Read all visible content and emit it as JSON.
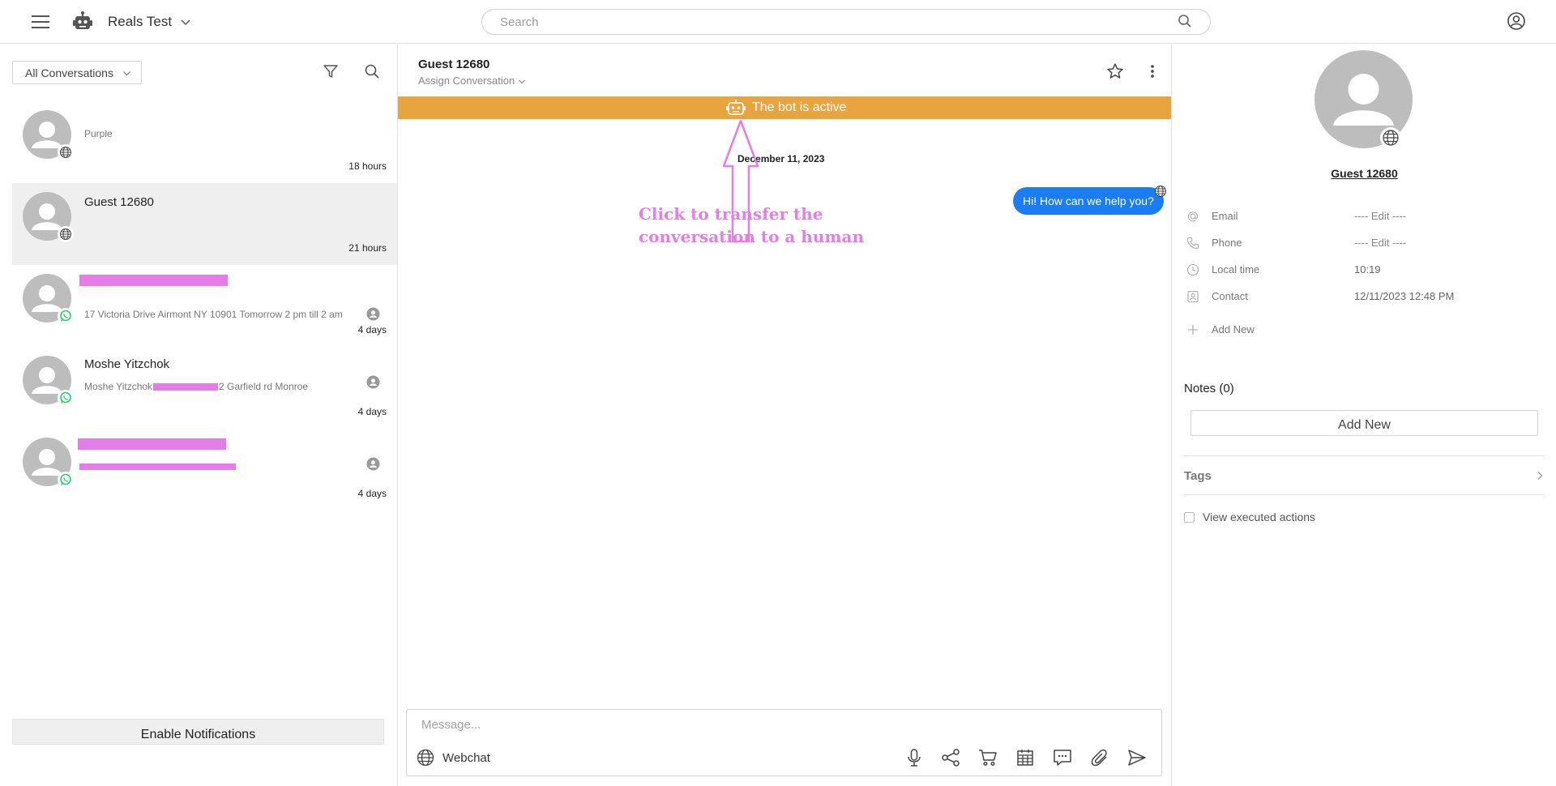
{
  "app": {
    "workspace_title": "Reals Test",
    "search_placeholder": "Search"
  },
  "left_panel": {
    "filter_label": "All Conversations",
    "conversations": [
      {
        "name": "",
        "preview": "Purple",
        "time": "18 hours",
        "channel": "webchat",
        "active": false
      },
      {
        "name": "Guest 12680",
        "preview": "",
        "time": "21 hours",
        "channel": "webchat",
        "active": true
      },
      {
        "name": "",
        "preview": "17 Victoria Drive Airmont NY 10901 Tomorrow 2 pm till 2 am",
        "time": "4 days",
        "channel": "whatsapp",
        "active": false
      },
      {
        "name": "Moshe Yitzchok",
        "preview_start": "Moshe Yitzchok",
        "preview_end": "2 Garfield rd Monroe",
        "time": "4 days",
        "channel": "whatsapp",
        "active": false
      },
      {
        "name": "",
        "preview": "",
        "time": "4 days",
        "channel": "whatsapp",
        "active": false
      }
    ],
    "enable_notifications_label": "Enable Notifications"
  },
  "chat": {
    "contact_name": "Guest 12680",
    "assign_label": "Assign Conversation",
    "bot_banner": "The bot is active",
    "date_separator": "December 11, 2023",
    "messages": [
      {
        "text": "Hi! How can we help you?",
        "direction": "outgoing"
      }
    ],
    "annotation": {
      "line1": "Click to transfer the",
      "line2": "conversation to a human"
    },
    "composer": {
      "placeholder": "Message...",
      "channel_label": "Webchat"
    }
  },
  "contact_panel": {
    "name": "Guest 12680",
    "fields": [
      {
        "label": "Email",
        "value": "---- Edit ----"
      },
      {
        "label": "Phone",
        "value": "---- Edit ----"
      },
      {
        "label": "Local time",
        "value": "10:19"
      },
      {
        "label": "Contact",
        "value": "12/11/2023 12:48 PM"
      }
    ],
    "add_new_label": "Add New",
    "notes_label": "Notes (0)",
    "add_note_label": "Add New",
    "tags_label": "Tags",
    "view_executed_label": "View executed actions"
  },
  "colors": {
    "bot_banner": "#e8a43f",
    "message_bubble": "#1a7ef2",
    "annotation": "#e47de8",
    "whatsapp": "#25d366",
    "avatar": "#bdbdbd"
  }
}
